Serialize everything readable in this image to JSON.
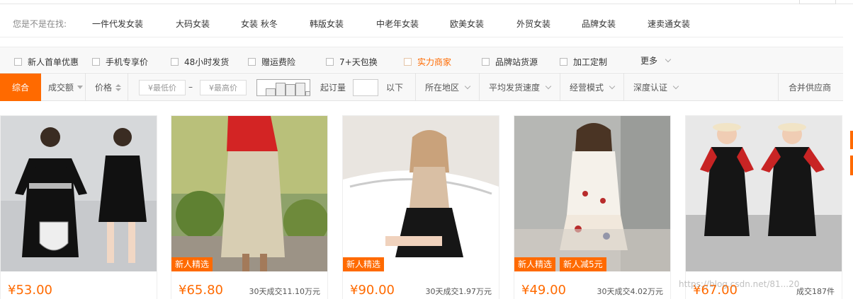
{
  "suggest": {
    "label": "您是不是在找:",
    "items": [
      "一件代发女装",
      "大码女装",
      "女装 秋冬",
      "韩版女装",
      "中老年女装",
      "欧美女装",
      "外贸女装",
      "品牌女装",
      "速卖通女装"
    ]
  },
  "filters": {
    "checkboxes": [
      "新人首单优惠",
      "手机专享价",
      "48小时发货",
      "赠运费险",
      "7+天包换",
      "实力商家",
      "品牌站货源",
      "加工定制"
    ],
    "more_label": "更多"
  },
  "sort": {
    "active": "综合",
    "volume": "成交额",
    "price": "价格",
    "min_price_placeholder": "¥最低价",
    "dash": "–",
    "max_price_placeholder": "¥最高价",
    "moq_label": "起订量",
    "below_label": "以下",
    "region": "所在地区",
    "ship_speed": "平均发货速度",
    "biz_mode": "经营模式",
    "cert": "深度认证",
    "merge": "合并供应商"
  },
  "products": [
    {
      "price": "¥53.00",
      "sales": "",
      "badges": []
    },
    {
      "price": "¥65.80",
      "sales": "30天成交11.10万元",
      "badges": [
        "新人精选"
      ]
    },
    {
      "price": "¥90.00",
      "sales": "30天成交1.97万元",
      "badges": [
        "新人精选"
      ]
    },
    {
      "price": "¥49.00",
      "sales": "30天成交4.02万元",
      "badges": [
        "新人精选",
        "新人减5元"
      ]
    },
    {
      "price": "¥67.00",
      "sales": "成交187件",
      "badges": []
    }
  ],
  "watermark": "https://blog.csdn.net/81...20",
  "colors": {
    "accent": "#ff6a00"
  }
}
